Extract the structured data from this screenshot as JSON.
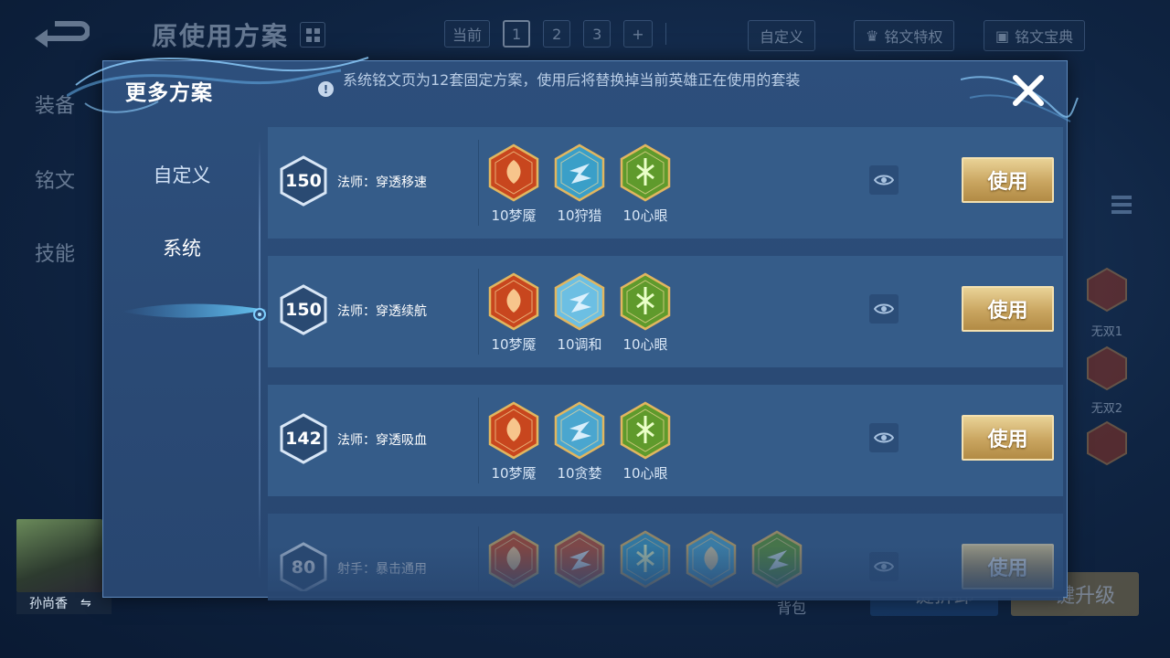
{
  "background": {
    "title": "原使用方案",
    "tabs": [
      {
        "label": "当前",
        "active": false
      },
      {
        "label": "1",
        "active": true
      },
      {
        "label": "2",
        "active": false
      },
      {
        "label": "3",
        "active": false
      },
      {
        "label": "+",
        "active": false
      }
    ],
    "custom_label": "自定义",
    "rune_privilege_label": "铭文特权",
    "rune_guide_label": "铭文宝典",
    "side_items": [
      "装备",
      "铭文",
      "技能"
    ],
    "right_runes": [
      "无双1",
      "无双2"
    ],
    "hero_name": "孙尚香",
    "bag_label": "背包",
    "one_click_label": "一键拆卸",
    "upgrade_label": "一键升级"
  },
  "modal": {
    "title": "更多方案",
    "notice": "系统铭文页为12套固定方案，使用后将替换掉当前英雄正在使用的套装",
    "nav": [
      {
        "label": "自定义",
        "active": false
      },
      {
        "label": "系统",
        "active": true
      }
    ],
    "use_label": "使用",
    "plans": [
      {
        "level": "150",
        "name": "法师：穿透移速",
        "runes": [
          {
            "label": "10梦魇",
            "icon": "rune-dream-red-icon",
            "color": "#c8461e"
          },
          {
            "label": "10狩猎",
            "icon": "rune-hunt-blue-icon",
            "color": "#3a9fc8"
          },
          {
            "label": "10心眼",
            "icon": "rune-mind-green-icon",
            "color": "#5f9a2c"
          }
        ]
      },
      {
        "level": "150",
        "name": "法师：穿透续航",
        "runes": [
          {
            "label": "10梦魇",
            "icon": "rune-dream-red-icon",
            "color": "#c8461e"
          },
          {
            "label": "10调和",
            "icon": "rune-harmony-blue-icon",
            "color": "#6cbfe3"
          },
          {
            "label": "10心眼",
            "icon": "rune-mind-green-icon",
            "color": "#5f9a2c"
          }
        ]
      },
      {
        "level": "142",
        "name": "法师：穿透吸血",
        "runes": [
          {
            "label": "10梦魇",
            "icon": "rune-dream-red-icon",
            "color": "#c8461e"
          },
          {
            "label": "10贪婪",
            "icon": "rune-greed-blue-icon",
            "color": "#4aa6cf"
          },
          {
            "label": "10心眼",
            "icon": "rune-mind-green-icon",
            "color": "#5f9a2c"
          }
        ]
      },
      {
        "level": "80",
        "name": "射手：暴击通用",
        "runes": [
          {
            "label": "",
            "icon": "rune-red-icon",
            "color": "#c8461e"
          },
          {
            "label": "",
            "icon": "rune-red-icon",
            "color": "#c24a2a"
          },
          {
            "label": "",
            "icon": "rune-blue-icon",
            "color": "#3a9fc8"
          },
          {
            "label": "",
            "icon": "rune-blue-icon",
            "color": "#4aa6cf"
          },
          {
            "label": "",
            "icon": "rune-green-icon",
            "color": "#5f9a2c"
          }
        ]
      }
    ]
  }
}
